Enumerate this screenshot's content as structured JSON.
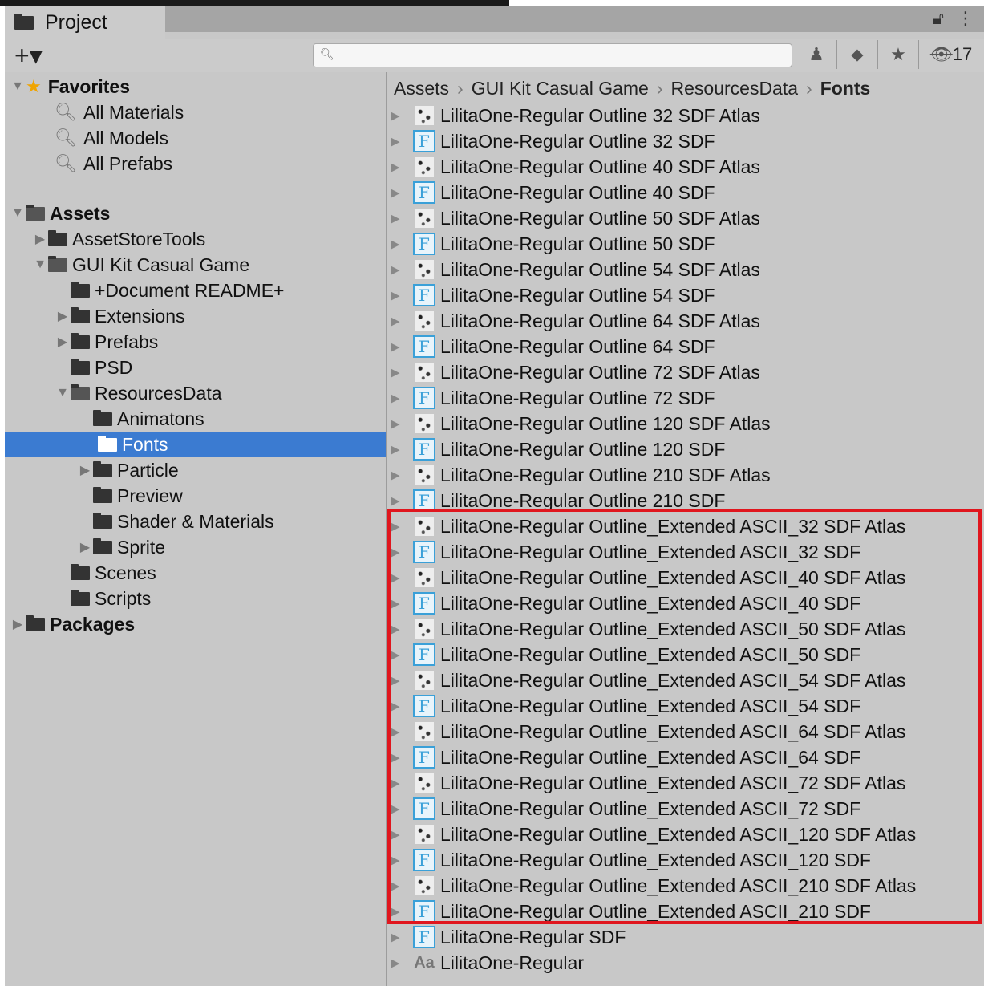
{
  "window": {
    "tab_label": "Project",
    "lock_icon": "lock-icon",
    "menu_icon": "kebab-menu-icon"
  },
  "toolbar": {
    "add_label": "+▾",
    "search_placeholder": "",
    "hidden_count": "17"
  },
  "tree": {
    "favorites": {
      "label": "Favorites",
      "items": [
        "All Materials",
        "All Models",
        "All Prefabs"
      ]
    },
    "assets_label": "Assets",
    "asset_store_tools": "AssetStoreTools",
    "gui_kit": "GUI Kit Casual Game",
    "readme": "+Document README+",
    "extensions": "Extensions",
    "prefabs": "Prefabs",
    "psd": "PSD",
    "resources_data": "ResourcesData",
    "animatons": "Animatons",
    "fonts": "Fonts",
    "particle": "Particle",
    "preview": "Preview",
    "shader": "Shader & Materials",
    "sprite": "Sprite",
    "scenes": "Scenes",
    "scripts": "Scripts",
    "packages": "Packages"
  },
  "breadcrumb": [
    "Assets",
    "GUI Kit Casual Game",
    "ResourcesData",
    "Fonts"
  ],
  "files": [
    {
      "name": "LilitaOne-Regular Outline 32 SDF Atlas",
      "kind": "atlas"
    },
    {
      "name": "LilitaOne-Regular Outline 32 SDF",
      "kind": "font"
    },
    {
      "name": "LilitaOne-Regular Outline 40 SDF Atlas",
      "kind": "atlas"
    },
    {
      "name": "LilitaOne-Regular Outline 40 SDF",
      "kind": "font"
    },
    {
      "name": "LilitaOne-Regular Outline 50 SDF Atlas",
      "kind": "atlas"
    },
    {
      "name": "LilitaOne-Regular Outline 50 SDF",
      "kind": "font"
    },
    {
      "name": "LilitaOne-Regular Outline 54 SDF Atlas",
      "kind": "atlas"
    },
    {
      "name": "LilitaOne-Regular Outline 54 SDF",
      "kind": "font"
    },
    {
      "name": "LilitaOne-Regular Outline 64 SDF Atlas",
      "kind": "atlas"
    },
    {
      "name": "LilitaOne-Regular Outline 64 SDF",
      "kind": "font"
    },
    {
      "name": "LilitaOne-Regular Outline 72 SDF Atlas",
      "kind": "atlas"
    },
    {
      "name": "LilitaOne-Regular Outline 72 SDF",
      "kind": "font"
    },
    {
      "name": "LilitaOne-Regular Outline 120 SDF Atlas",
      "kind": "atlas"
    },
    {
      "name": "LilitaOne-Regular Outline 120 SDF",
      "kind": "font"
    },
    {
      "name": "LilitaOne-Regular Outline 210 SDF Atlas",
      "kind": "atlas"
    },
    {
      "name": "LilitaOne-Regular Outline 210 SDF",
      "kind": "font"
    },
    {
      "name": "LilitaOne-Regular Outline_Extended ASCII_32 SDF Atlas",
      "kind": "atlas"
    },
    {
      "name": "LilitaOne-Regular Outline_Extended ASCII_32 SDF",
      "kind": "font"
    },
    {
      "name": "LilitaOne-Regular Outline_Extended ASCII_40 SDF Atlas",
      "kind": "atlas"
    },
    {
      "name": "LilitaOne-Regular Outline_Extended ASCII_40 SDF",
      "kind": "font"
    },
    {
      "name": "LilitaOne-Regular Outline_Extended ASCII_50 SDF Atlas",
      "kind": "atlas"
    },
    {
      "name": "LilitaOne-Regular Outline_Extended ASCII_50 SDF",
      "kind": "font"
    },
    {
      "name": "LilitaOne-Regular Outline_Extended ASCII_54 SDF Atlas",
      "kind": "atlas"
    },
    {
      "name": "LilitaOne-Regular Outline_Extended ASCII_54 SDF",
      "kind": "font"
    },
    {
      "name": "LilitaOne-Regular Outline_Extended ASCII_64 SDF Atlas",
      "kind": "atlas"
    },
    {
      "name": "LilitaOne-Regular Outline_Extended ASCII_64 SDF",
      "kind": "font"
    },
    {
      "name": "LilitaOne-Regular Outline_Extended ASCII_72 SDF Atlas",
      "kind": "atlas"
    },
    {
      "name": "LilitaOne-Regular Outline_Extended ASCII_72 SDF",
      "kind": "font"
    },
    {
      "name": "LilitaOne-Regular Outline_Extended ASCII_120 SDF Atlas",
      "kind": "atlas"
    },
    {
      "name": "LilitaOne-Regular Outline_Extended ASCII_120 SDF",
      "kind": "font"
    },
    {
      "name": "LilitaOne-Regular Outline_Extended ASCII_210 SDF Atlas",
      "kind": "atlas"
    },
    {
      "name": "LilitaOne-Regular Outline_Extended ASCII_210 SDF",
      "kind": "font"
    },
    {
      "name": "LilitaOne-Regular SDF",
      "kind": "font"
    },
    {
      "name": "LilitaOne-Regular",
      "kind": "ttf"
    }
  ],
  "icons": {
    "font_asset_glyph": "F",
    "ttf_glyph": "Aa"
  },
  "colors": {
    "selection": "#3b7bd1",
    "highlight_box": "#e0161e",
    "font_icon": "#3aa0d8",
    "favorites_star": "#f0a400"
  }
}
